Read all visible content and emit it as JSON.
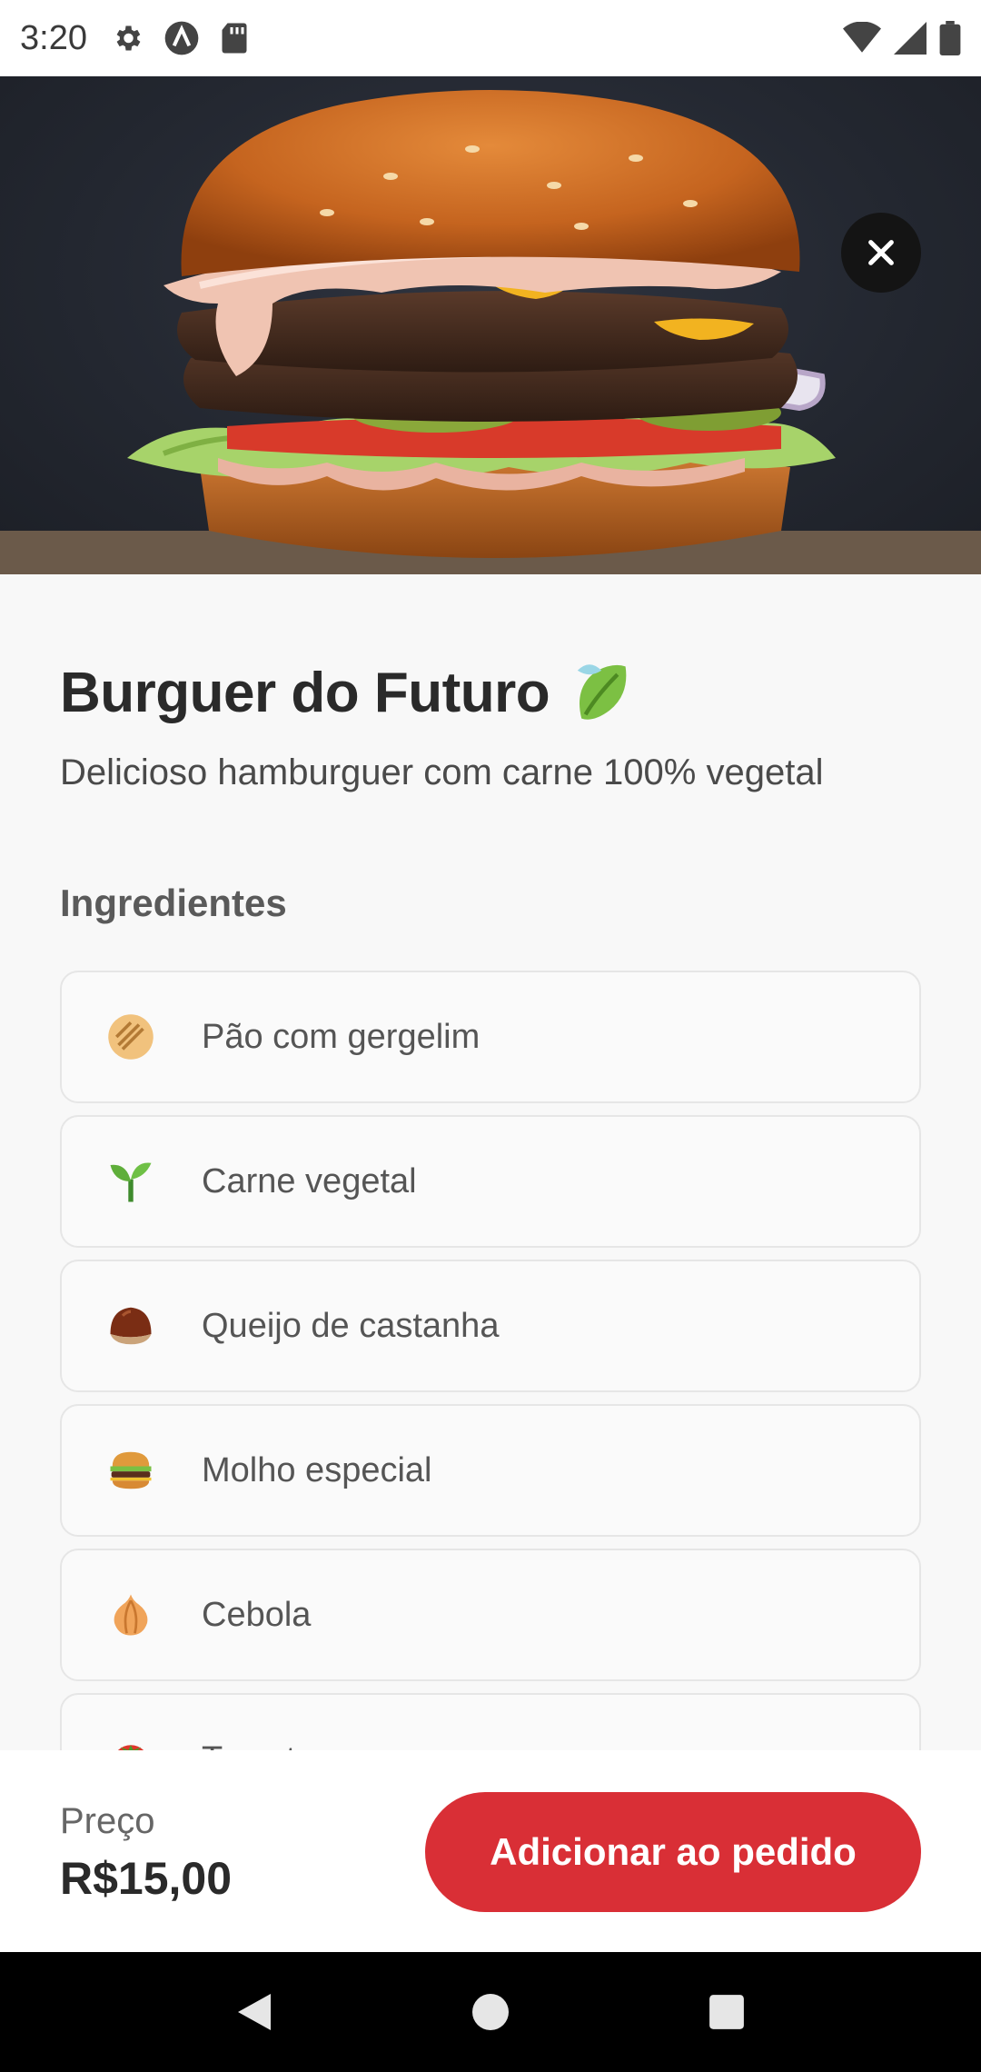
{
  "status_bar": {
    "time": "3:20",
    "left_icons": [
      "gear-icon",
      "app-icon",
      "sd-card-icon"
    ],
    "right_icons": [
      "wifi-icon",
      "signal-icon",
      "battery-icon"
    ]
  },
  "hero": {
    "image": "burger-photo",
    "close_icon": "close-icon"
  },
  "product": {
    "title": "Burguer do Futuro",
    "title_icon": "leaf-icon",
    "description": "Delicioso hamburguer com carne 100% vegetal"
  },
  "ingredients_section": {
    "title": "Ingredientes",
    "items": [
      {
        "label": "Pão com gergelim",
        "icon": "bread-icon"
      },
      {
        "label": "Carne vegetal",
        "icon": "seedling-icon"
      },
      {
        "label": "Queijo de castanha",
        "icon": "chestnut-icon"
      },
      {
        "label": "Molho especial",
        "icon": "burger-icon"
      },
      {
        "label": "Cebola",
        "icon": "onion-icon"
      },
      {
        "label": "Tomate",
        "icon": "tomato-icon"
      }
    ]
  },
  "order": {
    "price_label": "Preço",
    "price_value": "R$15,00",
    "add_button_label": "Adicionar ao pedido"
  },
  "nav_bar": {
    "buttons": [
      "back-icon",
      "home-icon",
      "recents-icon"
    ]
  },
  "colors": {
    "accent": "#d92f36",
    "text_primary": "#2a2a2a",
    "card_border": "#e6e6e6"
  }
}
